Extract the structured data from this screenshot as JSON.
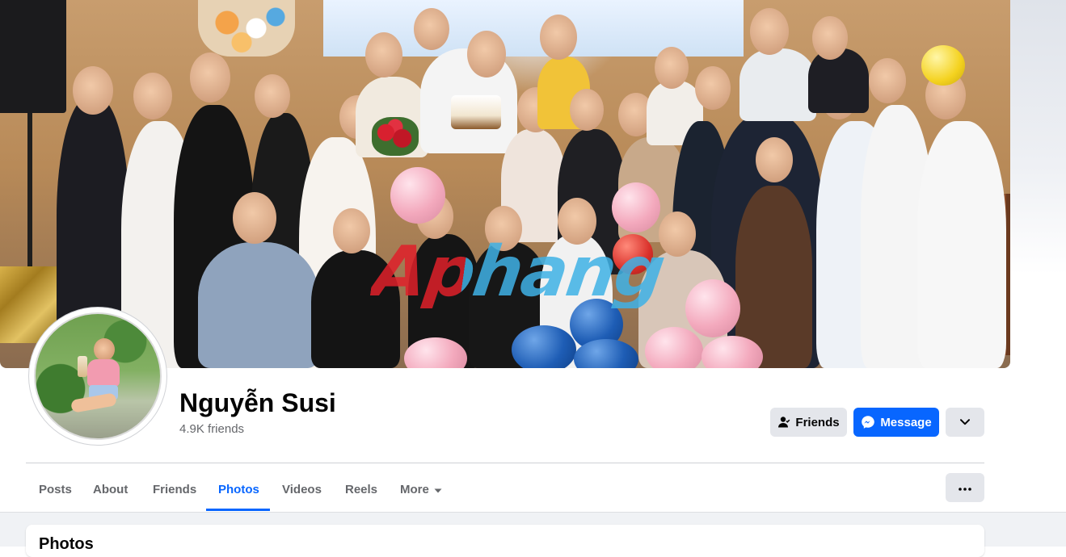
{
  "profile": {
    "name": "Nguyễn Susi",
    "friends_count": "4.9K friends"
  },
  "cover": {
    "watermark_text": "Aphang"
  },
  "actions": {
    "friends_label": "Friends",
    "message_label": "Message"
  },
  "tabs": [
    {
      "label": "Posts",
      "active": false
    },
    {
      "label": "About",
      "active": false
    },
    {
      "label": "Friends",
      "active": false
    },
    {
      "label": "Photos",
      "active": true
    },
    {
      "label": "Videos",
      "active": false
    },
    {
      "label": "Reels",
      "active": false
    },
    {
      "label": "More",
      "active": false
    }
  ],
  "photos_section": {
    "title": "Photos"
  },
  "colors": {
    "accent": "#0866ff",
    "secondary_button": "#e4e6eb",
    "muted_text": "#65676b",
    "page_background": "#f0f2f5"
  },
  "icons": {
    "friends_button": "person-check-icon",
    "message_button": "messenger-icon",
    "dropdown": "chevron-down-icon",
    "tab_more": "caret-down-icon",
    "overflow": "more-dots-icon"
  }
}
